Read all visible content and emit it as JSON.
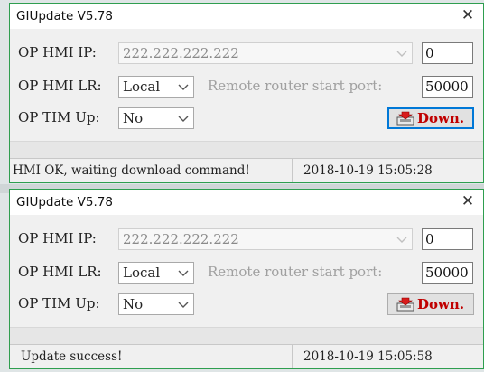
{
  "windows": [
    {
      "title": "GIUpdate V5.78",
      "close_glyph": "✕",
      "labels": {
        "ip": "OP HMI IP:",
        "lr": "OP HMI LR:",
        "tim": "OP TIM Up:"
      },
      "ip_value": "222.222.222.222",
      "ip_index": "0",
      "lr_value": "Local",
      "router_port_label": "Remote router start port:",
      "router_port_value": "50000",
      "tim_value": "No",
      "download_label": "Down.",
      "status_message": "HMI OK, waiting download command!",
      "status_datetime": "2018-10-19   15:05:28"
    },
    {
      "title": "GIUpdate V5.78",
      "close_glyph": "✕",
      "labels": {
        "ip": "OP HMI IP:",
        "lr": "OP HMI LR:",
        "tim": "OP TIM Up:"
      },
      "ip_value": "222.222.222.222",
      "ip_index": "0",
      "lr_value": "Local",
      "router_port_label": "Remote router start port:",
      "router_port_value": "50000",
      "tim_value": "No",
      "download_label": "Down.",
      "status_message": "Update success!",
      "status_datetime": "2018-10-19   15:05:58"
    }
  ],
  "icons": {
    "dropdown": "chevron-down-icon",
    "download": "download-icon",
    "close": "close-icon"
  },
  "colors": {
    "window_border": "#2e9e4f",
    "focus_border": "#0078d7",
    "download_text": "#c00000",
    "client_background": "#f0f0f0"
  }
}
